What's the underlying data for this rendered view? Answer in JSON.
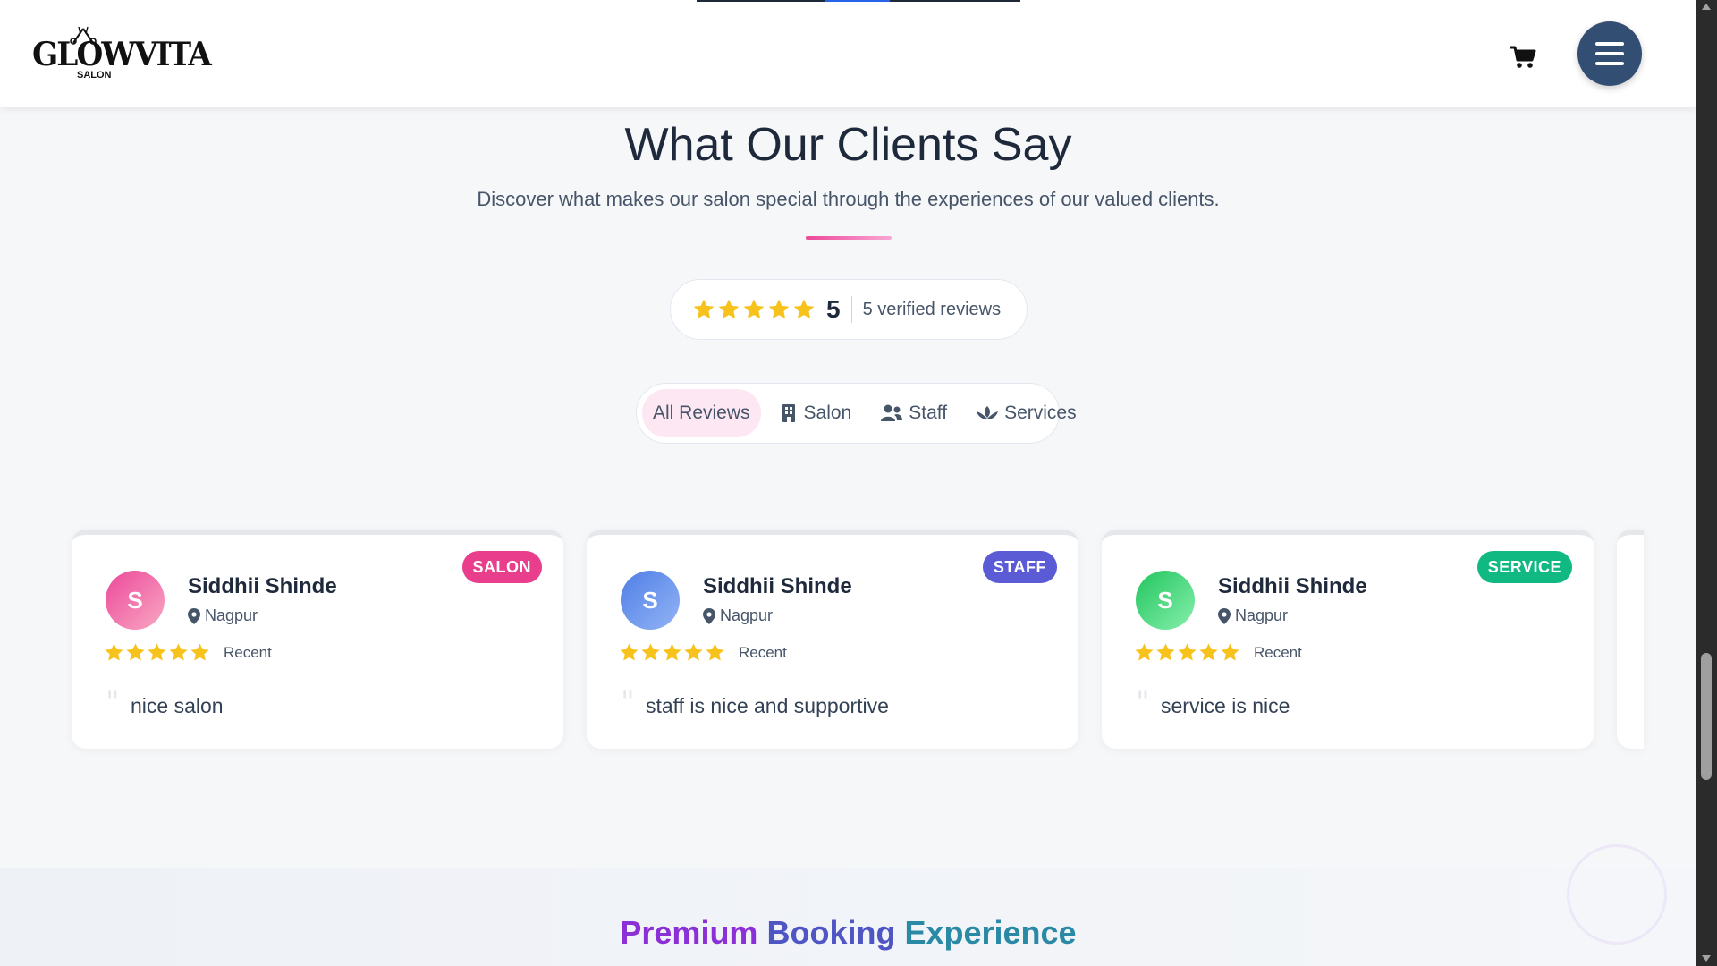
{
  "header": {
    "logo_text": "GLOWVITA",
    "logo_subtext": "SALON",
    "cart_icon": "cart-icon",
    "menu_icon": "hamburger-menu-icon"
  },
  "section": {
    "title": "What Our Clients Say",
    "subtitle": "Discover what makes our salon special through the experiences of our valued clients.",
    "accent_color": "#ec4899"
  },
  "summary": {
    "rating": "5",
    "rating_value": 5,
    "count_label": "5 verified reviews"
  },
  "tabs": [
    {
      "label": "All Reviews",
      "icon": "",
      "active": true
    },
    {
      "label": "Salon",
      "icon": "building-icon",
      "active": false
    },
    {
      "label": "Staff",
      "icon": "users-icon",
      "active": false
    },
    {
      "label": "Services",
      "icon": "spa-icon",
      "active": false
    }
  ],
  "reviews": [
    {
      "initial": "S",
      "name": "Siddhii Shinde",
      "location": "Nagpur",
      "badge": "SALON",
      "badge_color": "#e83e8c",
      "avatar_gradient": [
        "#ec4899",
        "#f9a8c4"
      ],
      "stars": 5,
      "recency": "Recent",
      "text": "nice salon"
    },
    {
      "initial": "S",
      "name": "Siddhii Shinde",
      "location": "Nagpur",
      "badge": "STAFF",
      "badge_color": "#5b5bd6",
      "avatar_gradient": [
        "#4f7fe6",
        "#93b4f5"
      ],
      "stars": 5,
      "recency": "Recent",
      "text": "staff is nice and supportive"
    },
    {
      "initial": "S",
      "name": "Siddhii Shinde",
      "location": "Nagpur",
      "badge": "SERVICE",
      "badge_color": "#10b981",
      "avatar_gradient": [
        "#22c55e",
        "#86efac"
      ],
      "stars": 5,
      "recency": "Recent",
      "text": "service is nice"
    }
  ],
  "lower": {
    "title_words": [
      "Premium",
      "Booking",
      "Experience"
    ]
  },
  "colors": {
    "star": "#f7c21b",
    "menu_button": "#334e73"
  }
}
